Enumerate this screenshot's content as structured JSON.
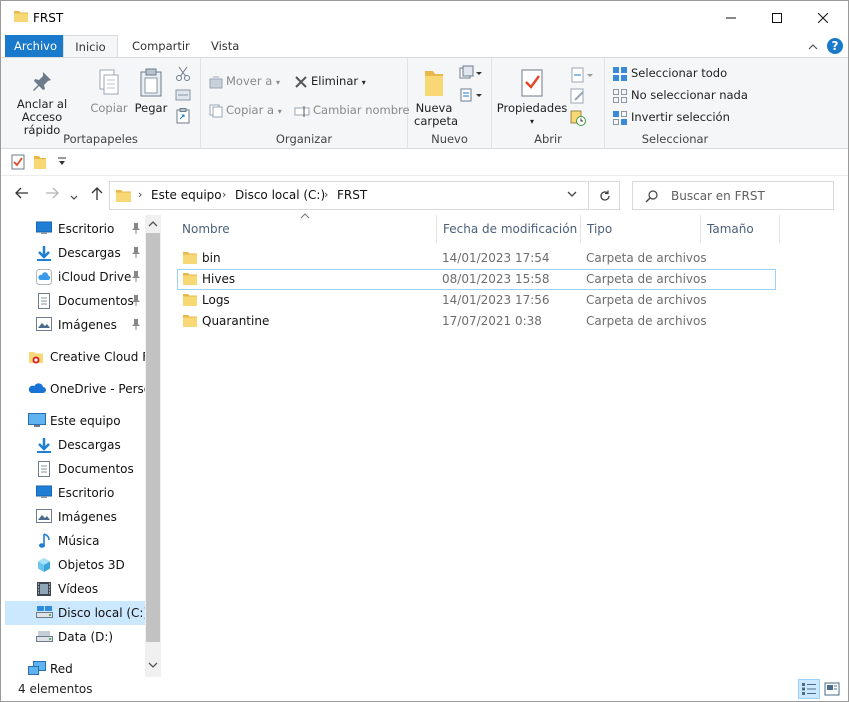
{
  "window": {
    "title": "FRST",
    "controls": {
      "minimize": "minimize-icon",
      "maximize": "maximize-icon",
      "close": "close-icon"
    }
  },
  "ribbon_tabs": [
    "Archivo",
    "Inicio",
    "Compartir",
    "Vista"
  ],
  "ribbon": {
    "portapapeles": {
      "label": "Portapapeles",
      "pin": "Anclar al\nAcceso rápido",
      "copy": "Copiar",
      "paste": "Pegar"
    },
    "organizar": {
      "label": "Organizar",
      "move": "Mover a",
      "copy_to": "Copiar a",
      "delete": "Eliminar",
      "rename": "Cambiar nombre"
    },
    "nuevo": {
      "label": "Nuevo",
      "new_folder": "Nueva\ncarpeta"
    },
    "abrir": {
      "label": "Abrir",
      "properties": "Propiedades"
    },
    "seleccionar": {
      "label": "Seleccionar",
      "select_all": "Seleccionar todo",
      "select_none": "No seleccionar nada",
      "invert": "Invertir selección"
    }
  },
  "address": {
    "crumbs": [
      "Este equipo",
      "Disco local (C:)",
      "FRST"
    ]
  },
  "search": {
    "placeholder": "Buscar en FRST"
  },
  "nav": [
    {
      "label": "Escritorio",
      "icon": "desktop-icon",
      "pinned": true
    },
    {
      "label": "Descargas",
      "icon": "download-icon",
      "pinned": true
    },
    {
      "label": "iCloud Drive",
      "icon": "icloud-icon",
      "pinned": true
    },
    {
      "label": "Documentos",
      "icon": "documents-icon",
      "pinned": true
    },
    {
      "label": "Imágenes",
      "icon": "pictures-icon",
      "pinned": true
    },
    {
      "label": "Creative Cloud Fil",
      "icon": "creative-cloud-icon"
    },
    {
      "label": "OneDrive - Persor",
      "icon": "onedrive-icon"
    },
    {
      "label": "Este equipo",
      "icon": "computer-icon"
    },
    {
      "label": "Descargas",
      "icon": "download-icon"
    },
    {
      "label": "Documentos",
      "icon": "documents-icon"
    },
    {
      "label": "Escritorio",
      "icon": "desktop-icon"
    },
    {
      "label": "Imágenes",
      "icon": "pictures-icon"
    },
    {
      "label": "Música",
      "icon": "music-icon"
    },
    {
      "label": "Objetos 3D",
      "icon": "objects-3d-icon"
    },
    {
      "label": "Vídeos",
      "icon": "videos-icon"
    },
    {
      "label": "Disco local (C:)",
      "icon": "drive-icon",
      "selected": true
    },
    {
      "label": "Data (D:)",
      "icon": "drive-icon"
    },
    {
      "label": "Red",
      "icon": "network-icon"
    }
  ],
  "columns": [
    "Nombre",
    "Fecha de modificación",
    "Tipo",
    "Tamaño"
  ],
  "files": [
    {
      "name": "bin",
      "date": "14/01/2023 17:54",
      "type": "Carpeta de archivos"
    },
    {
      "name": "Hives",
      "date": "08/01/2023 15:58",
      "type": "Carpeta de archivos",
      "selected": true
    },
    {
      "name": "Logs",
      "date": "14/01/2023 17:56",
      "type": "Carpeta de archivos"
    },
    {
      "name": "Quarantine",
      "date": "17/07/2021 0:38",
      "type": "Carpeta de archivos"
    }
  ],
  "status": {
    "count": "4 elementos"
  },
  "colors": {
    "accent": "#1979ca",
    "selection": "#cce8ff",
    "folder": "#f8d775"
  }
}
